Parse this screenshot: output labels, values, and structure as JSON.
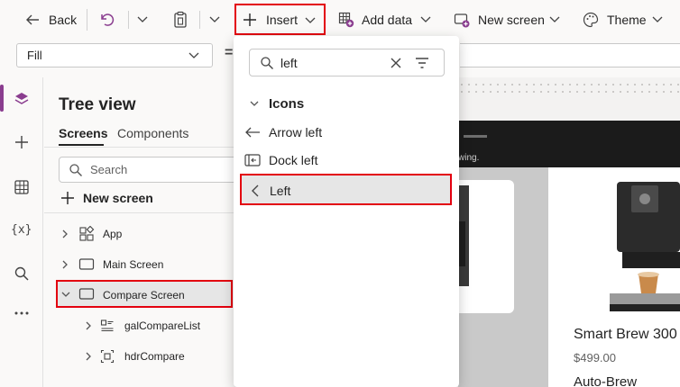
{
  "toolbar": {
    "back_label": "Back",
    "insert_label": "Insert",
    "add_data_label": "Add data",
    "new_screen_label": "New screen",
    "theme_label": "Theme"
  },
  "formula_bar": {
    "property_value": "Fill",
    "equals": "="
  },
  "tree_view": {
    "title": "Tree view",
    "tabs": [
      "Screens",
      "Components"
    ],
    "search_placeholder": "Search",
    "new_screen_label": "New screen",
    "items": [
      {
        "label": "App"
      },
      {
        "label": "Main Screen"
      },
      {
        "label": "Compare Screen"
      },
      {
        "label": "galCompareList"
      },
      {
        "label": "hdrCompare"
      }
    ]
  },
  "insert_menu": {
    "search_value": "left",
    "group_label": "Icons",
    "items": [
      {
        "label": "Arrow left"
      },
      {
        "label": "Dock left"
      },
      {
        "label": "Left"
      }
    ]
  },
  "canvas": {
    "banner_text": "wing.",
    "product_name": "Smart Brew 300",
    "product_price": "$499.00",
    "product_sub": "Auto-Brew"
  },
  "colors": {
    "accent": "#8a3d8f",
    "highlight": "#e3000f",
    "selected_bg": "#e6e6e6"
  }
}
